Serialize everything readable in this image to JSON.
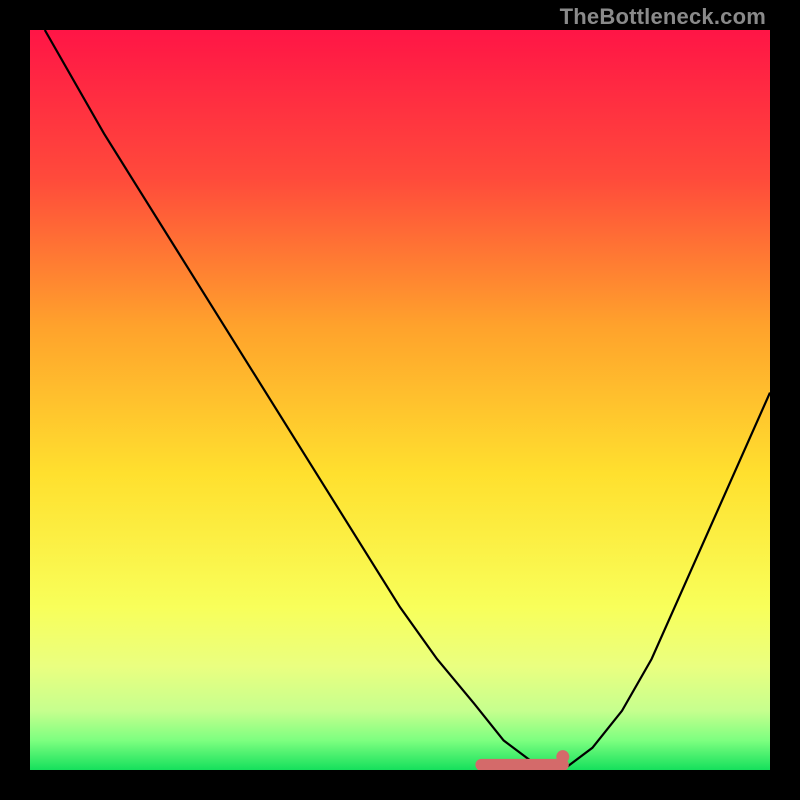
{
  "watermark": "TheBottleneck.com",
  "chart_data": {
    "type": "line",
    "title": "",
    "xlabel": "",
    "ylabel": "",
    "xlim": [
      0,
      100
    ],
    "ylim": [
      0,
      100
    ],
    "grid": false,
    "legend": false,
    "gradient_stops": [
      {
        "pct": 0,
        "color": "#ff1546"
      },
      {
        "pct": 20,
        "color": "#ff4a3b"
      },
      {
        "pct": 40,
        "color": "#ffa22c"
      },
      {
        "pct": 60,
        "color": "#ffe02e"
      },
      {
        "pct": 78,
        "color": "#f8ff5a"
      },
      {
        "pct": 86,
        "color": "#eaff80"
      },
      {
        "pct": 92,
        "color": "#c6ff8e"
      },
      {
        "pct": 96,
        "color": "#7dff80"
      },
      {
        "pct": 100,
        "color": "#15e05c"
      }
    ],
    "series": [
      {
        "name": "bottleneck-curve-left",
        "color": "#000000",
        "x": [
          2,
          10,
          20,
          30,
          40,
          50,
          55,
          60,
          64,
          68,
          72
        ],
        "y": [
          100,
          86,
          70,
          54,
          38,
          22,
          15,
          9,
          4,
          1,
          0
        ]
      },
      {
        "name": "bottleneck-curve-right",
        "color": "#000000",
        "x": [
          72,
          76,
          80,
          84,
          88,
          92,
          96,
          100
        ],
        "y": [
          0,
          3,
          8,
          15,
          24,
          33,
          42,
          51
        ]
      }
    ],
    "optimal_zone": {
      "name": "optimal-range-marker",
      "color": "#d46a6a",
      "x": [
        61,
        72
      ],
      "y": [
        0.7,
        0.7
      ],
      "endpoint": {
        "x": 72,
        "y": 1.8
      }
    }
  }
}
